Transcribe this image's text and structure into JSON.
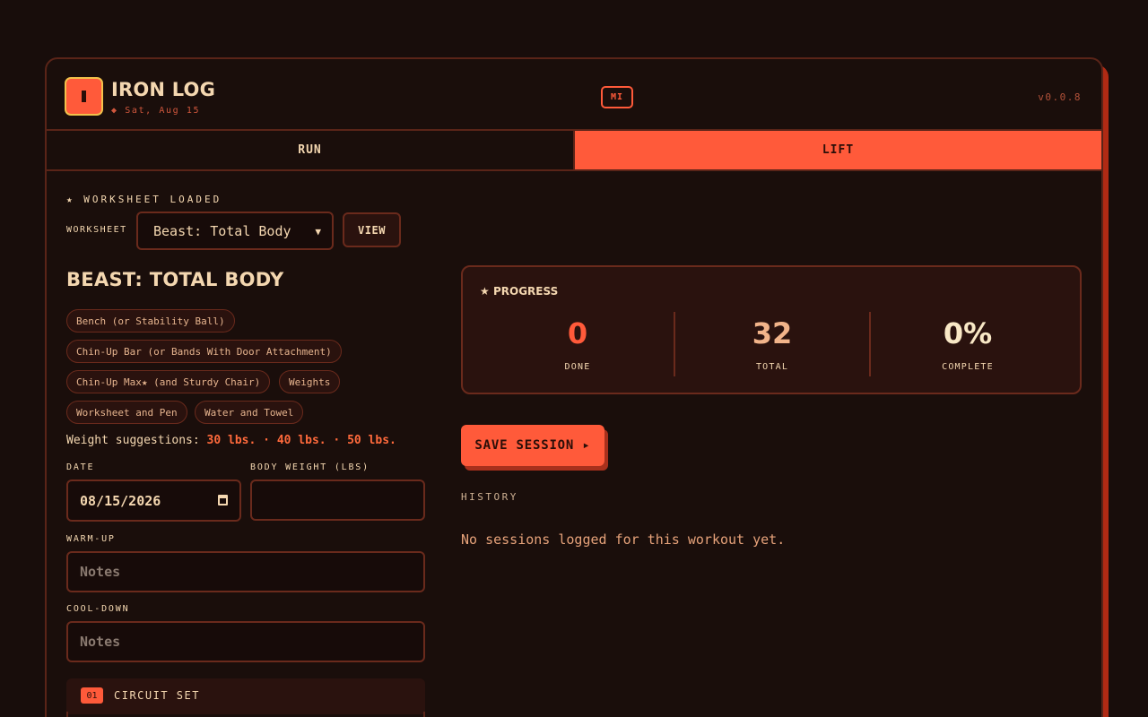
{
  "header": {
    "title": "IRON LOG",
    "date": "◆ Sat, Aug 15",
    "badge": "MI",
    "version": "v0.0.8"
  },
  "tabs": [
    {
      "label": "RUN",
      "active": false
    },
    {
      "label": "LIFT",
      "active": true
    }
  ],
  "worksheet": {
    "status": "★ WORKSHEET LOADED",
    "label": "WORKSHEET",
    "selected": "Beast: Total Body",
    "view_label": "VIEW"
  },
  "workout": {
    "title": "BEAST: TOTAL BODY",
    "equipment": [
      "Bench (or Stability Ball)",
      "Chin-Up Bar (or Bands With Door Attachment)",
      "Chin-Up Max★ (and Sturdy Chair)",
      "Weights",
      "Worksheet and Pen",
      "Water and Towel"
    ],
    "weights_label": "Weight suggestions:",
    "weights_values": "30 lbs. · 40 lbs. · 50 lbs."
  },
  "form": {
    "date_label": "DATE",
    "date_value": "08/15/2026",
    "body_weight_label": "BODY WEIGHT (LBS)",
    "body_weight_value": "",
    "warmup_label": "WARM-UP",
    "warmup_placeholder": "Notes",
    "cooldown_label": "COOL-DOWN",
    "cooldown_placeholder": "Notes"
  },
  "circuit": {
    "number": "01",
    "label": "CIRCUIT SET"
  },
  "progress": {
    "title": "PROGRESS",
    "done_value": "0",
    "done_label": "DONE",
    "total_value": "32",
    "total_label": "TOTAL",
    "complete_value": "0%",
    "complete_label": "COMPLETE"
  },
  "actions": {
    "save_label": "SAVE SESSION ▸"
  },
  "history": {
    "label": "HISTORY",
    "empty_text": "No sessions logged for this workout yet."
  },
  "colors": {
    "accent": "#ff5a3a",
    "background": "#180d0b",
    "text": "#f4d7b0",
    "highlight": "#ff6a3c"
  },
  "icons": {
    "logo": "app-logo-icon",
    "progress": "star-icon",
    "select": "chevron-down-icon",
    "date": "calendar-icon"
  }
}
